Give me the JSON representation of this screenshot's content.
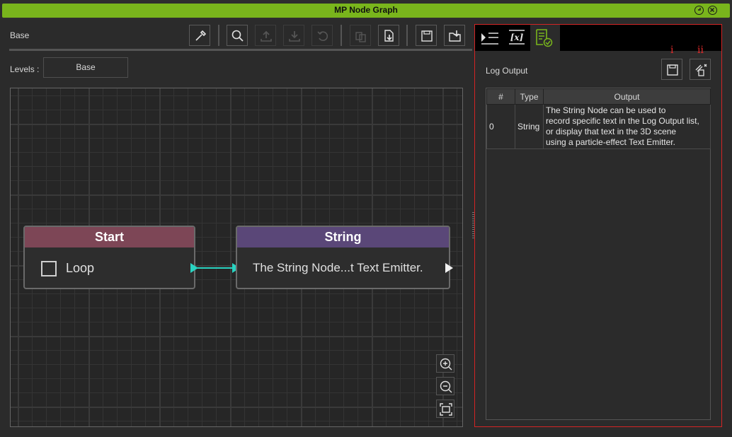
{
  "window": {
    "title": "MP Node Graph"
  },
  "graph": {
    "breadcrumb": "Base",
    "levels_label": "Levels :",
    "levels_value": "Base",
    "nodes": {
      "start": {
        "title": "Start",
        "checkbox_label": "Loop",
        "checked": false
      },
      "string": {
        "title": "String",
        "value": "The String Node...t Text Emitter."
      }
    },
    "colors": {
      "start_header": "#7d4656",
      "string_header": "#5a4778",
      "wire": "#29d3c1",
      "accent": "#79b51c"
    }
  },
  "toolbar": {
    "icons": [
      "eyedropper-icon",
      "search-icon",
      "upload-icon",
      "download-icon",
      "undo-icon",
      "copy-icon",
      "export-icon",
      "save-icon",
      "open-folder-icon"
    ]
  },
  "log_panel": {
    "tabs": [
      "console-tab",
      "variables-tab",
      "log-output-tab"
    ],
    "label": "Log Output",
    "markers": {
      "save": "i",
      "clear": "ii"
    },
    "table": {
      "headers": [
        "#",
        "Type",
        "Output"
      ],
      "rows": [
        {
          "index": "0",
          "type": "String",
          "output": "The String Node can be used to\nrecord specific text in the Log Output list,\nor display that text in the 3D scene\nusing a particle-effect Text Emitter."
        }
      ]
    }
  }
}
